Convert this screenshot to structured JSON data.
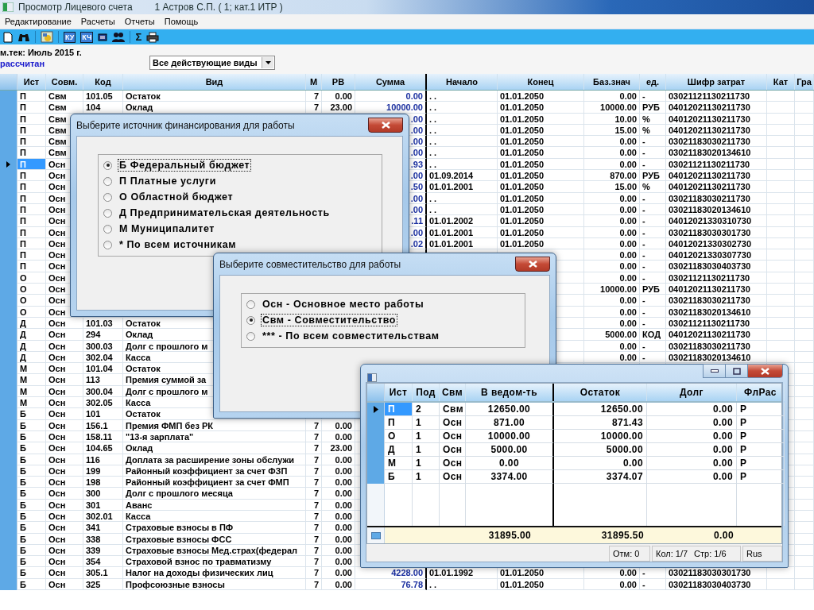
{
  "window": {
    "title": "Просмотр Лицевого счета",
    "subtitle": "1 Астров С.П. ( 1; кат.1 ИТР )"
  },
  "menu": [
    "Редактирование",
    "Расчеты",
    "Отчеты",
    "Помощь"
  ],
  "toolbar": [
    {
      "kind": "new"
    },
    {
      "kind": "find"
    },
    {
      "kind": "separator"
    },
    {
      "kind": "image"
    },
    {
      "kind": "separator"
    },
    {
      "kind": "label",
      "label": "КУ"
    },
    {
      "kind": "label",
      "label": "КЧ"
    },
    {
      "kind": "card"
    },
    {
      "kind": "people"
    },
    {
      "kind": "separator"
    },
    {
      "kind": "symbol",
      "label": "Σ"
    },
    {
      "kind": "print"
    }
  ],
  "period": "м.тек: Июль 2015 г.",
  "status": "рассчитан",
  "filter": {
    "value": "Все действующие виды"
  },
  "grid": {
    "columns": [
      "Ист",
      "Совм.",
      "Код",
      "Вид",
      "М",
      "РВ",
      "Сумма",
      "Начало",
      "Конец",
      "Баз.знач",
      "ед.",
      "Шифр затрат",
      "Кат",
      "Гра"
    ],
    "rows": [
      {
        "selected": false,
        "cells": [
          "П",
          "Свм",
          "101.05",
          "Остаток",
          "7",
          "0.00",
          "0.00",
          ". .",
          "01.01.2050",
          "0.00",
          "-",
          "03021121130211730"
        ]
      },
      {
        "selected": false,
        "cells": [
          "П",
          "Свм",
          "104",
          "Оклад",
          "7",
          "23.00",
          "10000.00",
          ". .",
          "01.01.2050",
          "10000.00",
          "РУБ",
          "04012021130211730"
        ]
      },
      {
        "selected": false,
        "cells": [
          "П",
          "Свм",
          null,
          null,
          null,
          null,
          ".00",
          ". .",
          "01.01.2050",
          "10.00",
          "%",
          "04012021130211730"
        ]
      },
      {
        "selected": false,
        "cells": [
          "П",
          "Свм",
          null,
          null,
          null,
          null,
          ".00",
          ". .",
          "01.01.2050",
          "15.00",
          "%",
          "04012021130211730"
        ]
      },
      {
        "selected": false,
        "cells": [
          "П",
          "Свм",
          null,
          null,
          null,
          null,
          ".00",
          ". .",
          "01.01.2050",
          "0.00",
          "-",
          "03021183030211730"
        ]
      },
      {
        "selected": false,
        "cells": [
          "П",
          "Свм",
          null,
          null,
          null,
          null,
          ".00",
          ". .",
          "01.01.2050",
          "0.00",
          "-",
          "03021183020134610"
        ]
      },
      {
        "selected": true,
        "cells": [
          "П",
          "Осн",
          null,
          null,
          null,
          null,
          ".93",
          ". .",
          "01.01.2050",
          "0.00",
          "-",
          "03021121130211730"
        ]
      },
      {
        "selected": false,
        "cells": [
          "П",
          "Осн",
          null,
          null,
          null,
          null,
          ".00",
          "01.09.2014",
          "01.01.2050",
          "870.00",
          "РУБ",
          "04012021130211730"
        ]
      },
      {
        "selected": false,
        "cells": [
          "П",
          "Осн",
          null,
          null,
          null,
          null,
          ".50",
          "01.01.2001",
          "01.01.2050",
          "15.00",
          "%",
          "04012021130211730"
        ]
      },
      {
        "selected": false,
        "cells": [
          "П",
          "Осн",
          null,
          null,
          null,
          null,
          ".00",
          ". .",
          "01.01.2050",
          "0.00",
          "-",
          "03021183030211730"
        ]
      },
      {
        "selected": false,
        "cells": [
          "П",
          "Осн",
          null,
          null,
          null,
          null,
          ".00",
          ". .",
          "01.01.2050",
          "0.00",
          "-",
          "03021183020134610"
        ]
      },
      {
        "selected": false,
        "cells": [
          "П",
          "Осн",
          null,
          null,
          null,
          null,
          ".11",
          "01.01.2002",
          "01.01.2050",
          "0.00",
          "-",
          "04012021330310730"
        ]
      },
      {
        "selected": false,
        "cells": [
          "П",
          "Осн",
          null,
          null,
          null,
          null,
          ".00",
          "01.01.2001",
          "01.01.2050",
          "0.00",
          "-",
          "03021183030301730"
        ]
      },
      {
        "selected": false,
        "cells": [
          "П",
          "Осн",
          null,
          null,
          null,
          null,
          ".02",
          "01.01.2001",
          "01.01.2050",
          "0.00",
          "-",
          "04012021330302730"
        ]
      },
      {
        "selected": false,
        "cells": [
          "П",
          "Осн",
          null,
          null,
          null,
          null,
          null,
          null,
          null,
          "0.00",
          "-",
          "04012021330307730"
        ]
      },
      {
        "selected": false,
        "cells": [
          "П",
          "Осн",
          null,
          null,
          null,
          null,
          null,
          null,
          null,
          "0.00",
          "-",
          "03021183030403730"
        ]
      },
      {
        "selected": false,
        "cells": [
          "О",
          "Осн",
          null,
          null,
          null,
          null,
          null,
          null,
          null,
          "0.00",
          "-",
          "03021121130211730"
        ]
      },
      {
        "selected": false,
        "cells": [
          "О",
          "Осн",
          null,
          null,
          null,
          null,
          null,
          null,
          null,
          "10000.00",
          "РУБ",
          "04012021130211730"
        ]
      },
      {
        "selected": false,
        "cells": [
          "О",
          "Осн",
          null,
          null,
          null,
          null,
          null,
          null,
          null,
          "0.00",
          "-",
          "03021183030211730"
        ]
      },
      {
        "selected": false,
        "cells": [
          "О",
          "Осн",
          null,
          null,
          null,
          null,
          null,
          null,
          null,
          "0.00",
          "-",
          "03021183020134610"
        ]
      },
      {
        "selected": false,
        "cells": [
          "Д",
          "Осн",
          "101.03",
          "Остаток",
          null,
          null,
          null,
          null,
          null,
          "0.00",
          "-",
          "03021121130211730"
        ]
      },
      {
        "selected": false,
        "cells": [
          "Д",
          "Осн",
          "294",
          "Оклад",
          null,
          null,
          null,
          null,
          null,
          "5000.00",
          "КОД",
          "04012021130211730"
        ]
      },
      {
        "selected": false,
        "cells": [
          "Д",
          "Осн",
          "300.03",
          "Долг с прошлого м",
          null,
          null,
          null,
          null,
          null,
          "0.00",
          "-",
          "03021183030211730"
        ]
      },
      {
        "selected": false,
        "cells": [
          "Д",
          "Осн",
          "302.04",
          "Касса",
          null,
          null,
          null,
          null,
          null,
          "0.00",
          "-",
          "03021183020134610"
        ]
      },
      {
        "selected": false,
        "cells": [
          "М",
          "Осн",
          "101.04",
          "Остаток"
        ]
      },
      {
        "selected": false,
        "cells": [
          "М",
          "Осн",
          "113",
          "Премия суммой за"
        ]
      },
      {
        "selected": false,
        "cells": [
          "М",
          "Осн",
          "300.04",
          "Долг с прошлого м"
        ]
      },
      {
        "selected": false,
        "cells": [
          "М",
          "Осн",
          "302.05",
          "Касса"
        ]
      },
      {
        "selected": false,
        "cells": [
          "Б",
          "Осн",
          "101",
          "Остаток"
        ]
      },
      {
        "selected": false,
        "cells": [
          "Б",
          "Осн",
          "156.1",
          "Премия ФМП без РК",
          "7",
          "0.00"
        ]
      },
      {
        "selected": false,
        "cells": [
          "Б",
          "Осн",
          "158.11",
          "\"13-я зарплата\"",
          "7",
          "0.00"
        ]
      },
      {
        "selected": false,
        "cells": [
          "Б",
          "Осн",
          "104.65",
          "Оклад",
          "7",
          "23.00"
        ]
      },
      {
        "selected": false,
        "cells": [
          "Б",
          "Осн",
          "116",
          "Доплата за расширение зоны обслужи",
          "7",
          "0.00"
        ]
      },
      {
        "selected": false,
        "cells": [
          "Б",
          "Осн",
          "199",
          "Районный коэффициент за счет ФЗП",
          "7",
          "0.00"
        ]
      },
      {
        "selected": false,
        "cells": [
          "Б",
          "Осн",
          "198",
          "Районный коэффициент за счет ФМП",
          "7",
          "0.00"
        ]
      },
      {
        "selected": false,
        "cells": [
          "Б",
          "Осн",
          "300",
          "Долг с прошлого месяца",
          "7",
          "0.00"
        ]
      },
      {
        "selected": false,
        "cells": [
          "Б",
          "Осн",
          "301",
          "Аванс",
          "7",
          "0.00"
        ]
      },
      {
        "selected": false,
        "cells": [
          "Б",
          "Осн",
          "302.01",
          "Касса",
          "7",
          "0.00"
        ]
      },
      {
        "selected": false,
        "cells": [
          "Б",
          "Осн",
          "341",
          "Страховые взносы в ПФ",
          "7",
          "0.00"
        ]
      },
      {
        "selected": false,
        "cells": [
          "Б",
          "Осн",
          "338",
          "Страховые взносы ФСС",
          "7",
          "0.00"
        ]
      },
      {
        "selected": false,
        "cells": [
          "Б",
          "Осн",
          "339",
          "Страховые взносы Мед.страх(федерал",
          "7",
          "0.00"
        ]
      },
      {
        "selected": false,
        "cells": [
          "Б",
          "Осн",
          "354",
          "Страховой взнос по травматизму",
          "7",
          "0.00"
        ]
      },
      {
        "selected": false,
        "cells": [
          "Б",
          "Осн",
          "305.1",
          "Налог на доходы физических лиц",
          "7",
          "0.00",
          "4228.00",
          "01.01.1992",
          "01.01.2050",
          "0.00",
          "-",
          "03021183030301730"
        ]
      },
      {
        "selected": false,
        "cells": [
          "Б",
          "Осн",
          "325",
          "Профсоюзные взносы",
          "7",
          "0.00",
          "76.78",
          ". .",
          "01.01.2050",
          "0.00",
          "-",
          "03021183030403730"
        ]
      }
    ]
  },
  "dialogs": [
    {
      "title": "Выберите источник финансирования для работы",
      "options": [
        {
          "label": "Б Федеральный бюджет",
          "selected": true
        },
        {
          "label": "П Платные услуги",
          "selected": false
        },
        {
          "label": "О Областной бюджет",
          "selected": false
        },
        {
          "label": "Д Предпринимательская деятельность",
          "selected": false
        },
        {
          "label": "М Муниципалитет",
          "selected": false
        },
        {
          "label": "* По всем источникам",
          "selected": false
        }
      ]
    },
    {
      "title": "Выберите совместительство для работы",
      "options": [
        {
          "label": "Осн - Основное место работы",
          "selected": false
        },
        {
          "label": "Свм - Совместительство",
          "selected": true
        },
        {
          "label": "*** - По всем совместительствам",
          "selected": false
        }
      ]
    }
  ],
  "summary_window": {
    "columns": [
      "Ист",
      "Под",
      "Свм",
      "В ведом-ть",
      "Остаток",
      "Долг",
      "ФлРас"
    ],
    "rows": [
      {
        "selected": true,
        "cells": [
          "П",
          "2",
          "Свм",
          "12650.00",
          "12650.00",
          "0.00",
          "Р"
        ]
      },
      {
        "selected": false,
        "cells": [
          "П",
          "1",
          "Осн",
          "871.00",
          "871.43",
          "0.00",
          "Р"
        ]
      },
      {
        "selected": false,
        "cells": [
          "О",
          "1",
          "Осн",
          "10000.00",
          "10000.00",
          "0.00",
          "Р"
        ]
      },
      {
        "selected": false,
        "cells": [
          "Д",
          "1",
          "Осн",
          "5000.00",
          "5000.00",
          "0.00",
          "Р"
        ]
      },
      {
        "selected": false,
        "cells": [
          "М",
          "1",
          "Осн",
          "0.00",
          "0.00",
          "0.00",
          "Р"
        ]
      },
      {
        "selected": false,
        "cells": [
          "Б",
          "1",
          "Осн",
          "3374.00",
          "3374.07",
          "0.00",
          "Р"
        ]
      }
    ],
    "totals": [
      "31895.00",
      "31895.50",
      "0.00"
    ],
    "status": [
      "Отм: 0",
      "Кол: 1/7",
      "Стр: 1/6",
      "Rus"
    ]
  }
}
